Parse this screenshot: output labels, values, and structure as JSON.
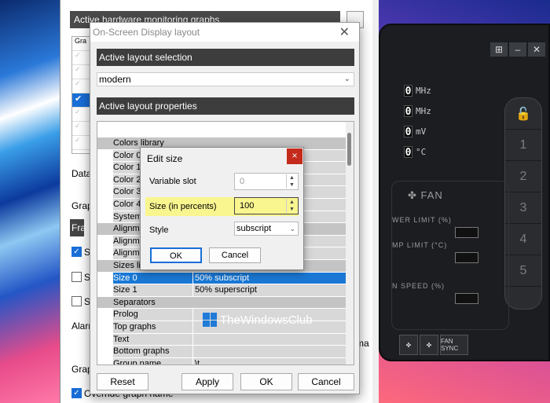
{
  "background": {
    "accent_left": "#2a78d8",
    "accent_right": "#d04a9e"
  },
  "afterburner": {
    "readouts": [
      {
        "value": "0",
        "unit": "MHz"
      },
      {
        "value": "0",
        "unit": "MHz"
      },
      {
        "value": "0",
        "unit": "mV"
      },
      {
        "value": "0",
        "unit": "°C"
      }
    ],
    "profiles": [
      "1",
      "2",
      "3",
      "4",
      "5"
    ],
    "fan_label": "FAN",
    "power_limit": "WER LIMIT (%)",
    "temp_limit": "MP LIMIT (°C)",
    "fan_speed": "N SPEED (%)",
    "fan_sync": "FAN SYNC"
  },
  "main_window": {
    "monitoring_header": "Active hardware monitoring graphs",
    "list_header": "Gra",
    "labels": {
      "data": "Data",
      "graph": "Grap",
      "alarm": "Alarm",
      "graph2": "Grap",
      "frame": "Fra",
      "sh1": "Sh",
      "sh2": "Sh",
      "sh3": "Sh",
      "ma": "ma",
      "overlay": "Override graph name"
    }
  },
  "osd_dialog": {
    "title": "On-Screen Display layout",
    "active_layout_selection": "Active layout selection",
    "selected_layout": "modern",
    "active_layout_properties": "Active layout properties",
    "rows": [
      {
        "type": "cat",
        "name": "Colors library",
        "value": ""
      },
      {
        "type": "item",
        "name": "Color 0",
        "value": ""
      },
      {
        "type": "item",
        "name": "Color 1",
        "value": ""
      },
      {
        "type": "item",
        "name": "Color 2",
        "value": ""
      },
      {
        "type": "item",
        "name": "Color 3",
        "value": ""
      },
      {
        "type": "item",
        "name": "Color 4",
        "value": ""
      },
      {
        "type": "item",
        "name": "System c",
        "value": ""
      },
      {
        "type": "cat",
        "name": "Alignmen",
        "value": ""
      },
      {
        "type": "item",
        "name": "Alignmen",
        "value": ""
      },
      {
        "type": "item",
        "name": "Alignmen",
        "value": ""
      },
      {
        "type": "cat",
        "name": "Sizes libr",
        "value": ""
      },
      {
        "type": "sel",
        "name": "Size 0",
        "value": "50% subscript"
      },
      {
        "type": "item",
        "name": "Size 1",
        "value": "50% superscript"
      },
      {
        "type": "cat",
        "name": "Separators",
        "value": ""
      },
      {
        "type": "item",
        "name": "Prolog",
        "value": ""
      },
      {
        "type": "item",
        "name": "Top graphs",
        "value": ""
      },
      {
        "type": "item",
        "name": "Text",
        "value": ""
      },
      {
        "type": "item",
        "name": "Bottom graphs",
        "value": ""
      },
      {
        "type": "item",
        "name": "Group name",
        "value": "\\t"
      }
    ],
    "buttons": {
      "reset": "Reset",
      "apply": "Apply",
      "ok": "OK",
      "cancel": "Cancel"
    }
  },
  "edit_size_dialog": {
    "title": "Edit size",
    "close": "×",
    "variable_slot_label": "Variable slot",
    "variable_slot_value": "0",
    "size_label": "Size (in percents)",
    "size_value": "100",
    "style_label": "Style",
    "style_value": "subscript",
    "ok": "OK",
    "cancel": "Cancel",
    "highlight_color": "#fff750"
  },
  "watermark": {
    "text": "TheWindowsClub"
  }
}
